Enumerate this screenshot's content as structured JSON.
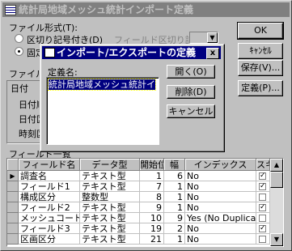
{
  "window": {
    "title": "統計局地域メッシュ統計インポート定義"
  },
  "main": {
    "file_format_label": "ファイル形式(T):",
    "radio_delimited": "区切り記号付き(D)",
    "radio_fixed": "固定長(W)",
    "field_delim_label": "フィールド区切り記号(I):",
    "field_info_label": "ファイルの",
    "date_group_label": "日付",
    "date_order_label": "日付順",
    "date_delim_label": "日付区",
    "time_delim_label": "時刻区",
    "field_list_label": "フィールド一覧"
  },
  "right_buttons": {
    "ok": "OK",
    "cancel": "ｷｬﾝｾﾙ",
    "save_as": "保存(V)...",
    "specs": "定義(P)..."
  },
  "dialog": {
    "title": "インポート/エクスポートの定義",
    "close": "x",
    "list_label": "定義名:",
    "list_items": [
      "統計局地域メッシュ統計インポート"
    ],
    "open": "開く(O)",
    "delete": "削除(D)",
    "cancel": "キャンセル"
  },
  "table": {
    "headers": [
      "フィールド名",
      "データ型",
      "開始位置",
      "幅",
      "インデックス",
      "スキップ"
    ],
    "rows": [
      {
        "name": "調査名",
        "type": "テキスト型",
        "start": "1",
        "width": "6",
        "index": "No",
        "skip": true
      },
      {
        "name": "フィールド1",
        "type": "テキスト型",
        "start": "7",
        "width": "1",
        "index": "No",
        "skip": true
      },
      {
        "name": "構成区分",
        "type": "整数型",
        "start": "8",
        "width": "1",
        "index": "No",
        "skip": false
      },
      {
        "name": "フィールド2",
        "type": "テキスト型",
        "start": "9",
        "width": "1",
        "index": "No",
        "skip": true
      },
      {
        "name": "メッシュコード",
        "type": "テキスト型",
        "start": "10",
        "width": "9",
        "index": "Yes (No Duplicat",
        "skip": false
      },
      {
        "name": "フィールド3",
        "type": "テキスト型",
        "start": "19",
        "width": "2",
        "index": "No",
        "skip": true
      },
      {
        "name": "区画区分",
        "type": "テキスト型",
        "start": "21",
        "width": "1",
        "index": "No",
        "skip": false
      }
    ]
  }
}
